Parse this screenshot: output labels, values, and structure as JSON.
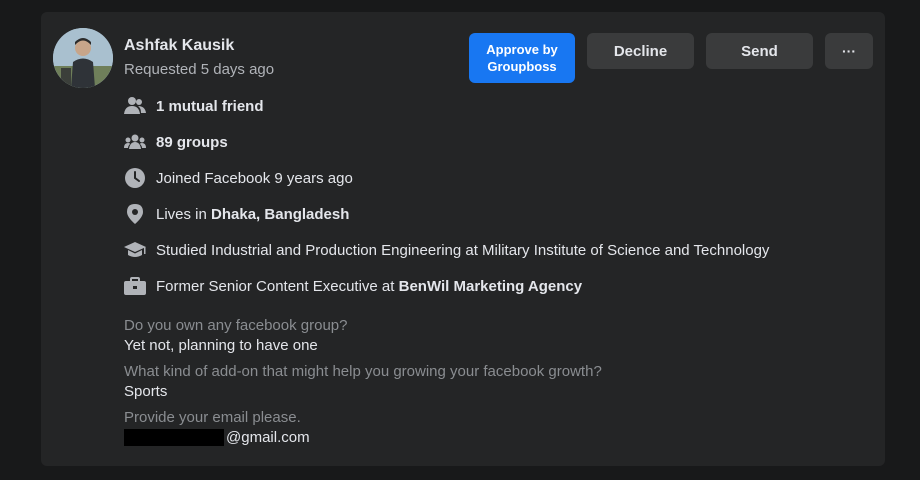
{
  "member": {
    "name": "Ashfak Kausik",
    "requested": "Requested 5 days ago"
  },
  "actions": {
    "approve_label": "Approve by Groupboss",
    "decline_label": "Decline",
    "send_label": "Send",
    "more_label": "···"
  },
  "details": [
    {
      "icon": "friends-icon",
      "text": "1 mutual friend"
    },
    {
      "icon": "groups-icon",
      "text": "89 groups"
    },
    {
      "icon": "clock-icon",
      "text": "Joined Facebook 9 years ago"
    },
    {
      "icon": "location-icon",
      "prefix": "Lives in ",
      "bold": "Dhaka, Bangladesh"
    },
    {
      "icon": "education-icon",
      "text": "Studied Industrial and Production Engineering at Military Institute of Science and Technology"
    },
    {
      "icon": "briefcase-icon",
      "prefix": "Former Senior Content Executive at ",
      "bold": "BenWil Marketing Agency"
    }
  ],
  "questions": [
    {
      "question": "Do you own any facebook group?",
      "answer": "Yet not, planning to have one"
    },
    {
      "question": "What kind of add-on that might help you growing your facebook growth?",
      "answer": "Sports"
    },
    {
      "question": "Provide your email please.",
      "answer": "@gmail.com"
    }
  ],
  "colors": {
    "background": "#18191a",
    "card": "#242526",
    "primary": "#1877f2",
    "secondary_button": "#3a3b3c",
    "muted_text": "#b0b3b8"
  }
}
